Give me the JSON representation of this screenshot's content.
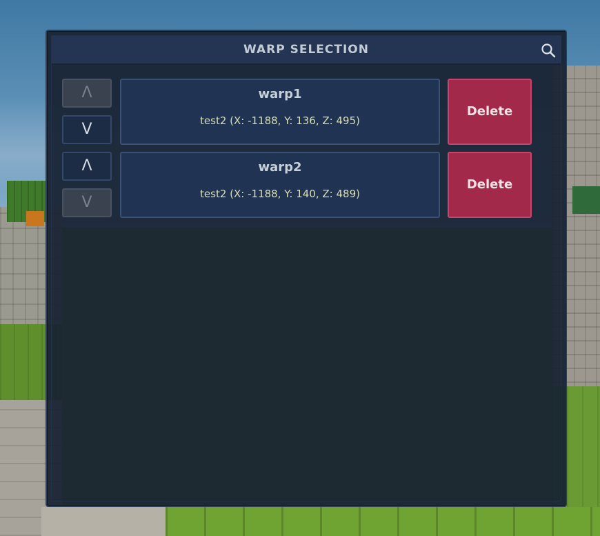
{
  "window": {
    "title": "WARP SELECTION",
    "search_icon": "search-icon"
  },
  "warps": [
    {
      "name": "warp1",
      "location": "test2 (X: -1188, Y: 136, Z: 495)",
      "up_label": "Λ",
      "down_label": "V",
      "up_enabled": false,
      "down_enabled": true,
      "delete_label": "Delete"
    },
    {
      "name": "warp2",
      "location": "test2 (X: -1188, Y: 140, Z: 489)",
      "up_label": "Λ",
      "down_label": "V",
      "up_enabled": true,
      "down_enabled": false,
      "delete_label": "Delete"
    }
  ],
  "colors": {
    "panel_bg": "#172131",
    "header_bg": "#233552",
    "card_bg": "#203352",
    "delete_bg": "#a3294a",
    "location_text": "#d9dfb2"
  }
}
